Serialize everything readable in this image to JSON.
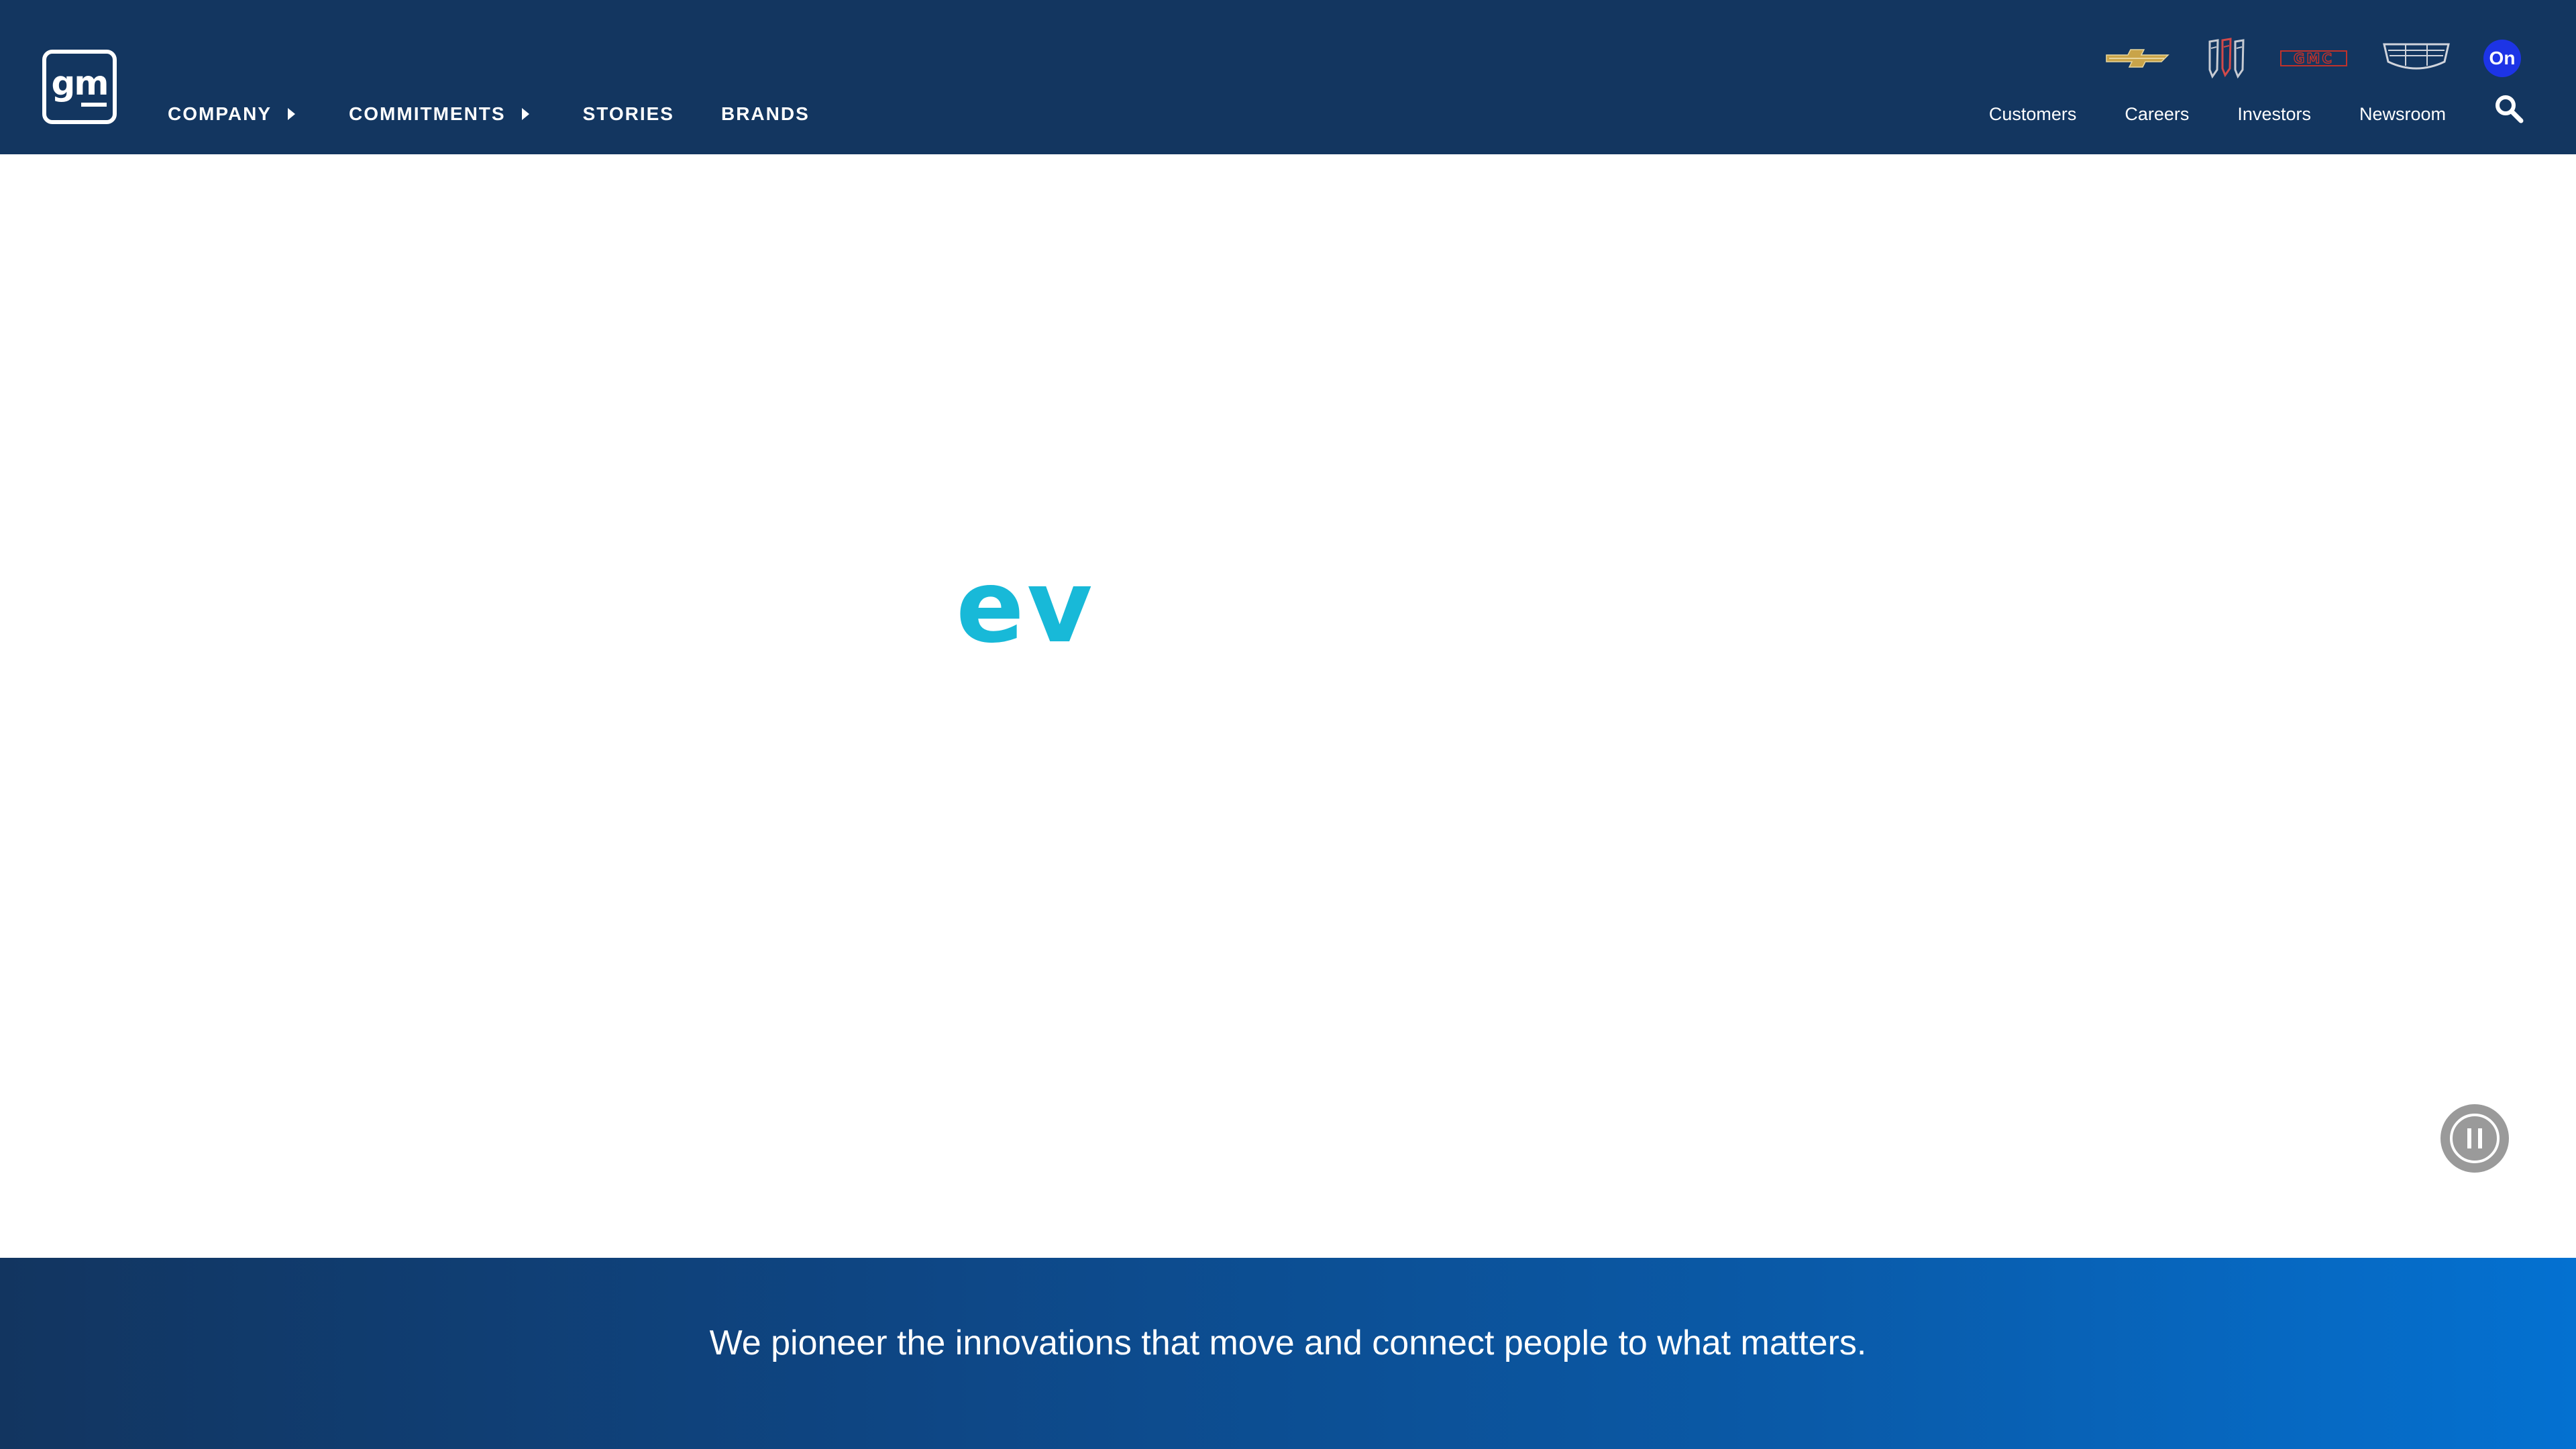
{
  "header": {
    "logo_text": "gm",
    "main_nav": {
      "company": "COMPANY",
      "commitments": "COMMITMENTS",
      "stories": "STORIES",
      "brands": "BRANDS"
    },
    "brands": [
      {
        "name": "chevrolet-logo"
      },
      {
        "name": "buick-logo"
      },
      {
        "name": "gmc-logo",
        "text": "GMC"
      },
      {
        "name": "cadillac-logo"
      },
      {
        "name": "onstar-logo",
        "text": "On"
      }
    ],
    "utility_nav": {
      "customers": "Customers",
      "careers": "Careers",
      "investors": "Investors",
      "newsroom": "Newsroom"
    },
    "search_icon": "search-icon"
  },
  "hero": {
    "animated_word": "ev",
    "pause_icon": "pause-icon"
  },
  "banner": {
    "tagline": "We pioneer the innovations that move and connect people to what matters."
  },
  "colors": {
    "header_bg": "#133660",
    "hero_accent": "#18b9d8",
    "onstar_blue": "#1d34e6",
    "chevy_gold": "#c9a449",
    "gmc_red": "#c0322b",
    "banner_start": "#123560",
    "banner_end": "#0471d1"
  }
}
